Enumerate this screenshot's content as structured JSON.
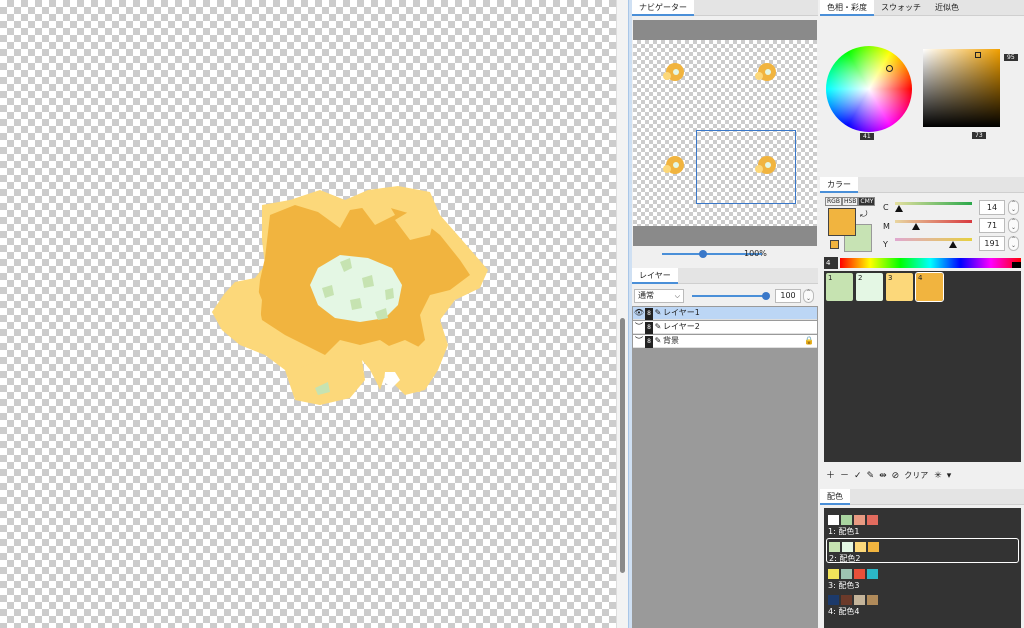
{
  "navigator": {
    "tab": "ナビゲーター",
    "zoom": "100%",
    "zoom_fraction": 0.55
  },
  "layers": {
    "tab": "レイヤー",
    "blend_mode": "通常",
    "opacity": "100",
    "opacity_fraction": 1.0,
    "items": [
      {
        "name": "レイヤー1",
        "selected": true,
        "visible": true,
        "locked": false
      },
      {
        "name": "レイヤー2",
        "selected": false,
        "visible": false,
        "locked": false
      },
      {
        "name": "背景",
        "selected": false,
        "visible": false,
        "locked": true
      }
    ]
  },
  "color_wheel_panel": {
    "tabs": [
      "色相・彩度",
      "スウォッチ",
      "近似色"
    ],
    "hue_value": "41",
    "saturation_value": "95",
    "brightness_value": "73"
  },
  "color_panel": {
    "tab": "カラー",
    "modes": [
      "RGB",
      "HSB",
      "CMY"
    ],
    "active_mode": "CMY",
    "channels": [
      {
        "label": "C",
        "value": "14",
        "fraction": 0.055
      },
      {
        "label": "M",
        "value": "71",
        "fraction": 0.28
      },
      {
        "label": "Y",
        "value": "191",
        "fraction": 0.75
      }
    ],
    "foreground": "#f1b43f",
    "background": "#c7e3b4",
    "palette_number": "4",
    "swatches": [
      {
        "label": "1",
        "color": "#c6e3b1"
      },
      {
        "label": "2",
        "color": "#e4f7e4"
      },
      {
        "label": "3",
        "color": "#fcd87a"
      },
      {
        "label": "4",
        "color": "#f1b43f"
      }
    ],
    "toolbar_clear": "クリア"
  },
  "haishoku": {
    "tab": "配色",
    "rows": [
      {
        "label": "1: 配色1",
        "colors": [
          "#ffffff",
          "#a9d4a0",
          "#e89a82",
          "#e26b5e"
        ]
      },
      {
        "label": "2: 配色2",
        "colors": [
          "#c6e3b1",
          "#e4f7e4",
          "#fcd87a",
          "#f1b43f"
        ],
        "selected": true
      },
      {
        "label": "3: 配色3",
        "colors": [
          "#f2e45a",
          "#9ec3b2",
          "#e8503a",
          "#2bb7c7"
        ]
      },
      {
        "label": "4: 配色4",
        "colors": [
          "#1c3a6b",
          "#6b3a2a",
          "#c4b49a",
          "#b08a5a"
        ]
      }
    ]
  },
  "colors": {
    "accent": "#4a8fd8",
    "dark_panel": "#333333",
    "selected_layer": "#bcd6f5"
  }
}
